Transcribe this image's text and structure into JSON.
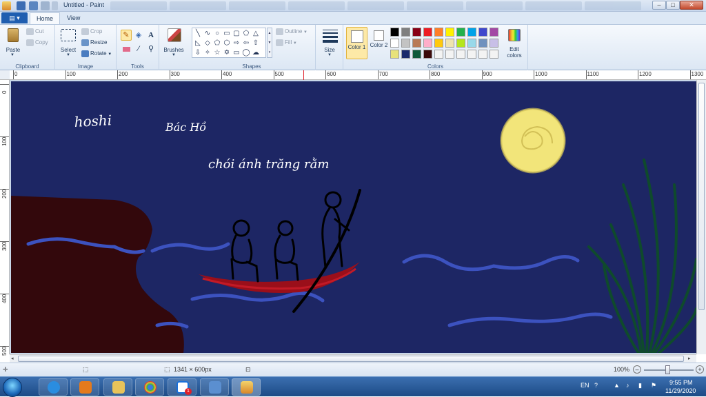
{
  "window": {
    "title": "Untitled - Paint",
    "ghost_tabs": [
      "",
      "",
      "",
      "",
      "",
      "",
      "",
      "",
      ""
    ],
    "controls": [
      "–",
      "□",
      "✕"
    ]
  },
  "ribbon_tabs": {
    "file": "▤ ▾",
    "home": "Home",
    "view": "View"
  },
  "clipboard": {
    "paste": "Paste",
    "cut": "Cut",
    "copy": "Copy",
    "label": "Clipboard"
  },
  "image": {
    "select": "Select",
    "crop": "Crop",
    "resize": "Resize",
    "rotate": "Rotate",
    "label": "Image"
  },
  "tools": {
    "label": "Tools",
    "text_tool": "A"
  },
  "brushes": {
    "label": "Brushes"
  },
  "shapes": {
    "label": "Shapes",
    "outline": "Outline",
    "fill": "Fill"
  },
  "size": {
    "label": "Size"
  },
  "colors": {
    "color1_label": "Color 1",
    "color2_label": "Color 2",
    "edit_label": "Edit colors",
    "group_label": "Colors",
    "color1": "#ffffff",
    "color2": "#ffffff",
    "palette": [
      "#000000",
      "#7f7f7f",
      "#880015",
      "#ed1c24",
      "#ff7f27",
      "#fff200",
      "#22b14c",
      "#00a2e8",
      "#3f48cc",
      "#a349a4",
      "#ffffff",
      "#c3c3c3",
      "#b97a57",
      "#ffaec9",
      "#ffc90e",
      "#efe4b0",
      "#b5e61d",
      "#99d9ea",
      "#7092be",
      "#c8bfe7",
      "#e8e27a",
      "#1b2a6b",
      "#0f5a3a",
      "#3b0a0a",
      "#f3f3f3",
      "#f3f3f3",
      "#f3f3f3",
      "#f3f3f3",
      "#f3f3f3",
      "#f3f3f3"
    ]
  },
  "ruler": {
    "h_labels": [
      "0",
      "100",
      "200",
      "300",
      "400",
      "500",
      "600",
      "700",
      "800",
      "900",
      "1000",
      "1100",
      "1200",
      "1300"
    ],
    "v_labels": [
      "0",
      "100",
      "200",
      "300",
      "400",
      "500"
    ]
  },
  "canvas": {
    "bg": "#1d2664",
    "text_hoshi": "hoshi",
    "text_bac_ho": "Bác Hồ",
    "text_line": "chói ánh trăng rằm"
  },
  "status": {
    "dimensions": "1341 × 600px",
    "zoom": "100%"
  },
  "tray": {
    "lang": "EN",
    "time": "9:55 PM",
    "date": "11/29/2020",
    "zalo_badge": "1"
  }
}
